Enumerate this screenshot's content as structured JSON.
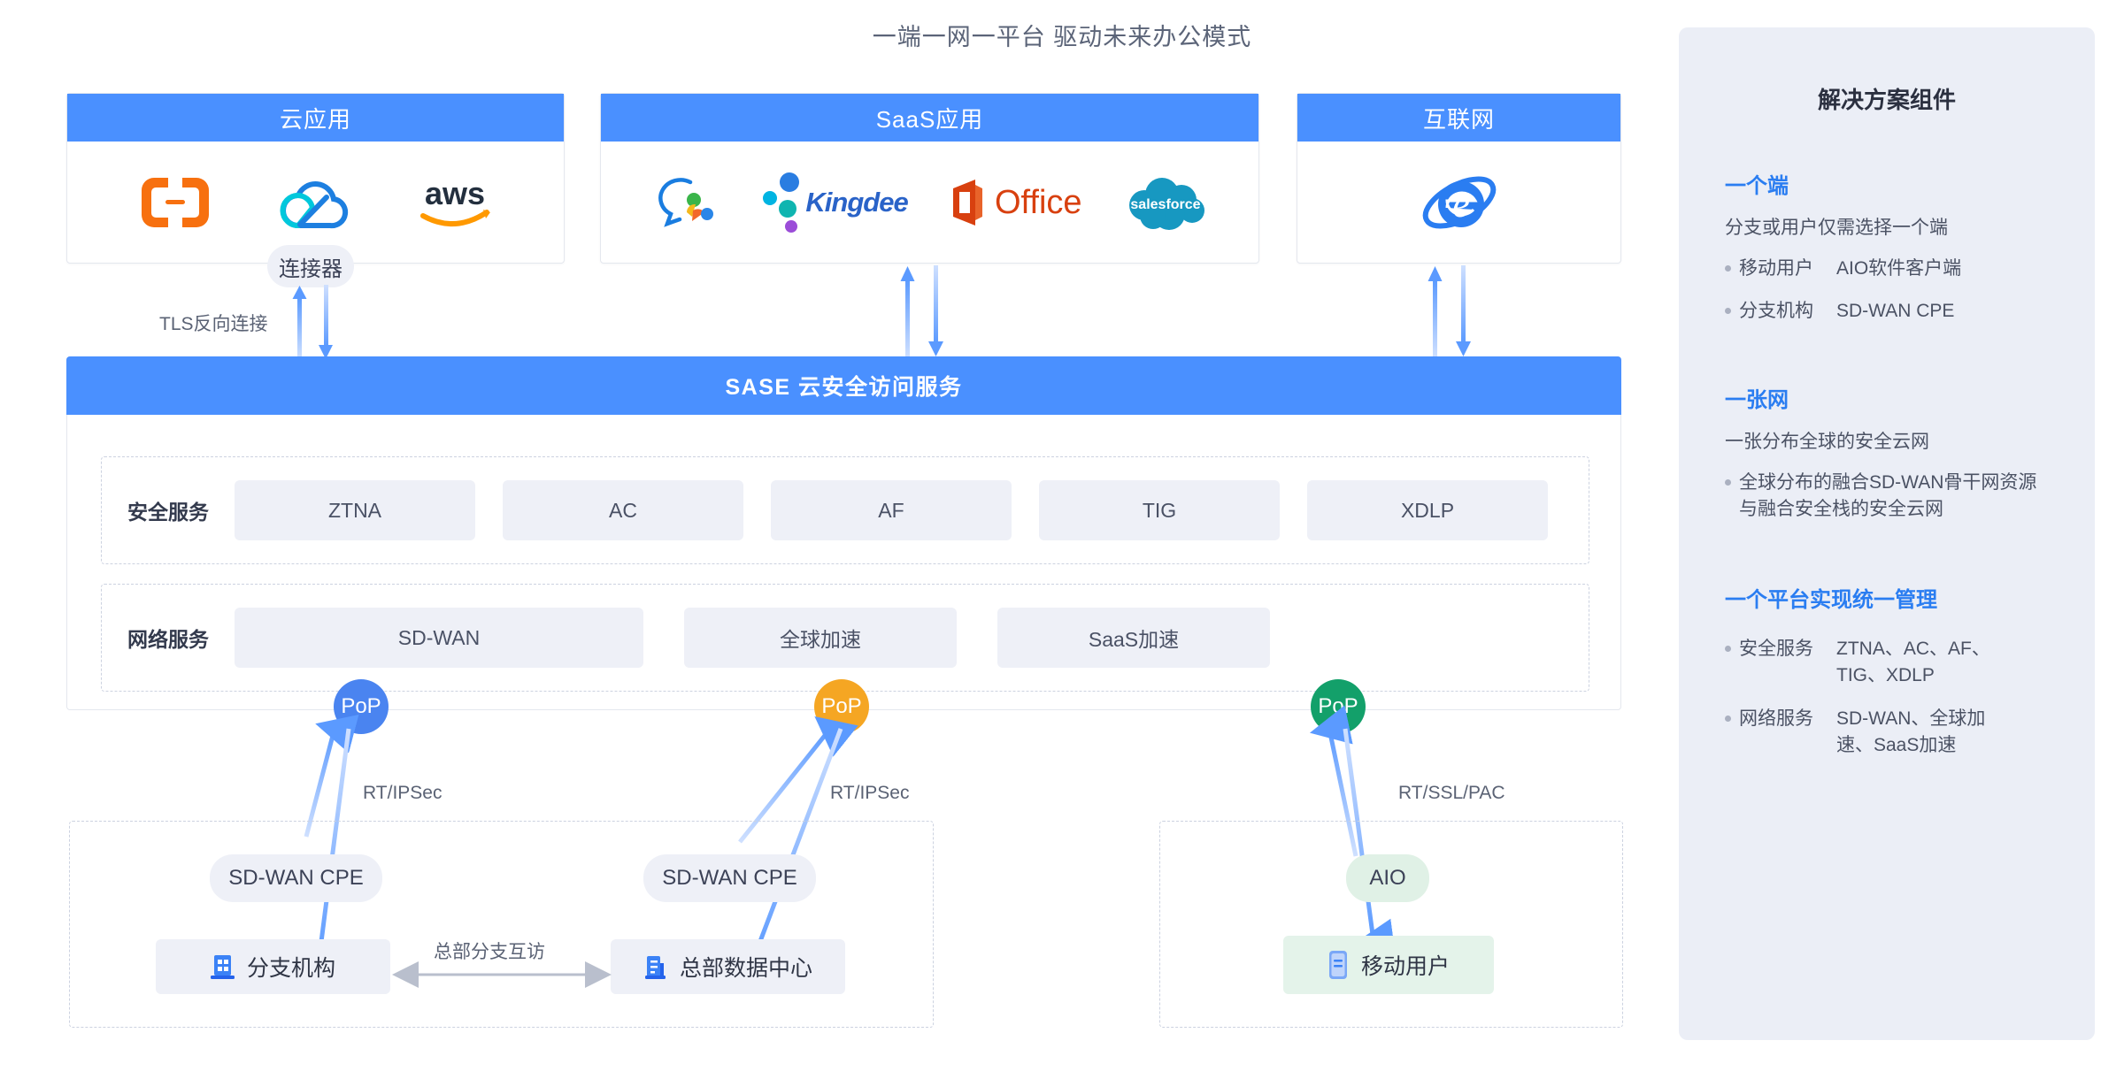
{
  "page": {
    "title": "一端一网一平台 驱动未来办公模式"
  },
  "top_panels": [
    {
      "id": "cloud-apps",
      "title": "云应用",
      "logos": [
        "aliyun-logo",
        "tencent-cloud-logo",
        "aws-logo"
      ]
    },
    {
      "id": "saas-apps",
      "title": "SaaS应用",
      "logos": [
        "dingtalk-logo",
        "kingdee-logo",
        "office-logo",
        "salesforce-logo"
      ],
      "logo_labels": [
        "",
        "Kingdee",
        "Office",
        "salesforce"
      ]
    },
    {
      "id": "internet",
      "title": "互联网",
      "logos": [
        "internet-explorer-logo"
      ]
    }
  ],
  "connector": {
    "label": "连接器",
    "link_label": "TLS反向连接"
  },
  "sase": {
    "title": "SASE  云安全访问服务",
    "security": {
      "label": "安全服务",
      "items": [
        "ZTNA",
        "AC",
        "AF",
        "TIG",
        "XDLP"
      ]
    },
    "network": {
      "label": "网络服务",
      "items": [
        "SD-WAN",
        "全球加速",
        "SaaS加速"
      ]
    }
  },
  "pops": [
    {
      "label": "PoP",
      "color": "#4a84f0"
    },
    {
      "label": "PoP",
      "color": "#f5a623"
    },
    {
      "label": "PoP",
      "color": "#13a06a"
    }
  ],
  "sites": [
    {
      "id": "branch",
      "cpe": "SD-WAN CPE",
      "link_label": "RT/IPSec",
      "node": "分支机构",
      "node_icon": "office-building-icon"
    },
    {
      "id": "hq",
      "cpe": "SD-WAN CPE",
      "link_label": "RT/IPSec",
      "node": "总部数据中心",
      "node_icon": "datacenter-building-icon"
    },
    {
      "id": "mobile",
      "cpe": "AIO",
      "link_label": "RT/SSL/PAC",
      "node": "移动用户",
      "node_icon": "mobile-phone-icon"
    }
  ],
  "interconnect_label": "总部分支互访",
  "sidebar": {
    "title": "解决方案组件",
    "sections": [
      {
        "heading": "一个端",
        "subtitle": "分支或用户仅需选择一个端",
        "items": [
          {
            "term": "移动用户",
            "value": "AIO软件客户端"
          },
          {
            "term": "分支机构",
            "value": "SD-WAN CPE"
          }
        ]
      },
      {
        "heading": "一张网",
        "subtitle": "一张分布全球的安全云网",
        "items": [
          {
            "term": "",
            "value": "全球分布的融合SD-WAN骨干网资源与融合安全栈的安全云网"
          }
        ]
      },
      {
        "heading": "一个平台实现统一管理",
        "subtitle": "",
        "items": [
          {
            "term": "安全服务",
            "value": "ZTNA、AC、AF、TIG、XDLP"
          },
          {
            "term": "网络服务",
            "value": "SD-WAN、全球加速、SaaS加速"
          }
        ]
      }
    ]
  },
  "colors": {
    "brand_blue": "#4a90ff",
    "accent_blue": "#2a7df1",
    "pop_orange": "#f5a623",
    "pop_green": "#13a06a",
    "chip_bg": "#eef0f7"
  }
}
